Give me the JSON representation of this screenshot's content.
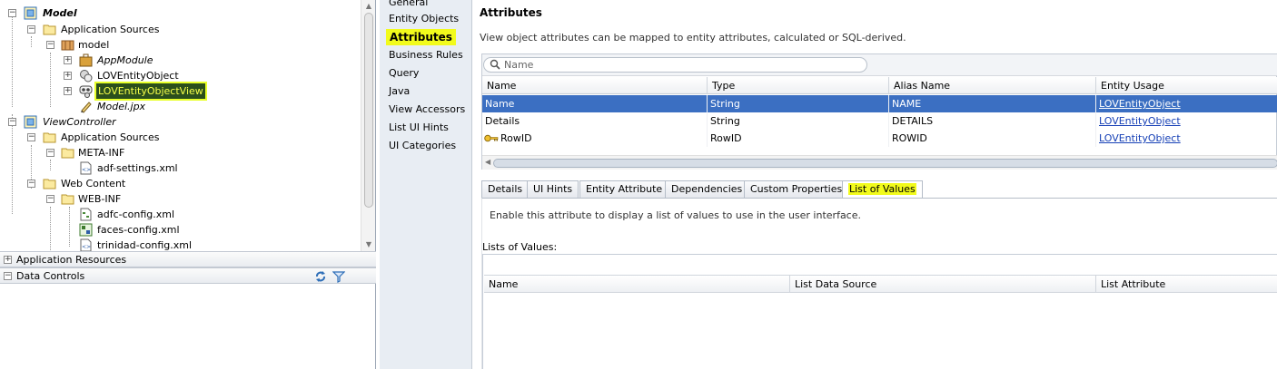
{
  "tree": {
    "items": [
      {
        "label": "Model",
        "icon": "project-icon"
      },
      {
        "label": "Application Sources",
        "icon": "folder-icon"
      },
      {
        "label": "model",
        "icon": "package-icon"
      },
      {
        "label": "AppModule",
        "icon": "application-module-icon"
      },
      {
        "label": "LOVEntityObject",
        "icon": "entity-object-icon"
      },
      {
        "label": "LOVEntityObjectView",
        "icon": "view-object-icon"
      },
      {
        "label": "Model.jpx",
        "icon": "project-file-icon"
      },
      {
        "label": "ViewController",
        "icon": "project-icon"
      },
      {
        "label": "Application Sources",
        "icon": "folder-icon"
      },
      {
        "label": "META-INF",
        "icon": "folder-icon"
      },
      {
        "label": "adf-settings.xml",
        "icon": "xml-file-icon"
      },
      {
        "label": "Web Content",
        "icon": "folder-icon"
      },
      {
        "label": "WEB-INF",
        "icon": "folder-icon"
      },
      {
        "label": "adfc-config.xml",
        "icon": "taskflow-file-icon"
      },
      {
        "label": "faces-config.xml",
        "icon": "faces-config-icon"
      },
      {
        "label": "trinidad-config.xml",
        "icon": "xml-file-icon"
      }
    ]
  },
  "panels": {
    "application_resources": "Application Resources",
    "data_controls": "Data Controls"
  },
  "nav": {
    "items": [
      "General",
      "Entity Objects",
      "Attributes",
      "Business Rules",
      "Query",
      "Java",
      "View Accessors",
      "List UI Hints",
      "UI Categories"
    ],
    "active": "Attributes"
  },
  "content": {
    "title": "Attributes",
    "description": "View object attributes can be mapped to entity attributes, calculated or SQL-derived.",
    "search_placeholder": "Name",
    "columns": [
      "Name",
      "Type",
      "Alias Name",
      "Entity Usage"
    ],
    "rows": [
      {
        "name": "Name",
        "type": "String",
        "alias": "NAME",
        "usage": "LOVEntityObject",
        "selected": true
      },
      {
        "name": "Details",
        "type": "String",
        "alias": "DETAILS",
        "usage": "LOVEntityObject",
        "selected": false
      },
      {
        "name": "RowID",
        "type": "RowID",
        "alias": "ROWID",
        "usage": "LOVEntityObject",
        "selected": false,
        "icon": "key-icon"
      }
    ],
    "tabs": [
      "Details",
      "UI Hints",
      "Entity Attribute",
      "Dependencies",
      "Custom Properties",
      "List of Values"
    ],
    "active_tab": "List of Values",
    "lov": {
      "description": "Enable this attribute to display a list of values to use in the user interface.",
      "label": "Lists of Values:",
      "columns": [
        "Name",
        "List Data Source",
        "List Attribute"
      ]
    }
  },
  "colors": {
    "highlight": "#f2fb1c",
    "selection": "#3b6fc2",
    "link": "#1640b6",
    "nav_bg": "#e8edf3"
  }
}
